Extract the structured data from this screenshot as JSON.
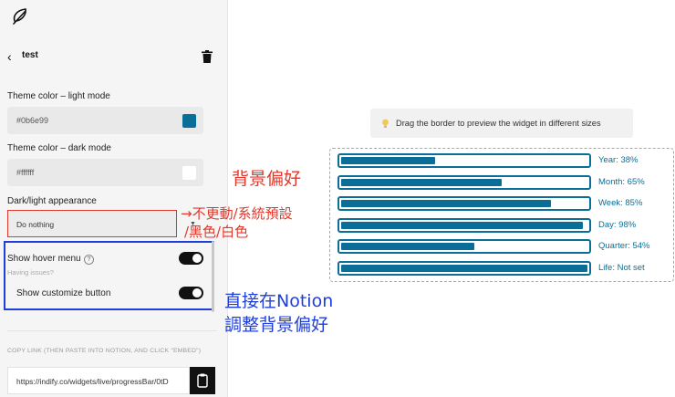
{
  "header": {
    "back_title": "test"
  },
  "settings": {
    "light_label": "Theme color – light mode",
    "light_value": "#0b6e99",
    "light_color": "#0b6e99",
    "dark_label": "Theme color – dark mode",
    "dark_value": "#ffffff",
    "dark_color": "#ffffff",
    "appearance_label": "Dark/light appearance",
    "appearance_value": "Do nothing",
    "hover_label": "Show hover menu",
    "having_issues": "Having issues?",
    "customize_label": "Show customize button",
    "copy_label": "COPY LINK (THEN PASTE INTO NOTION, AND CLICK \"EMBED\")",
    "link_value": "https://indify.co/widgets/live/progressBar/0tD"
  },
  "annotations": {
    "red_title": "背景偏好",
    "red_line1": "→不更動/系統預設",
    "red_line2": "/黑色/白色",
    "blue_line1": "直接在Notion",
    "blue_line2": "調整背景偏好"
  },
  "preview": {
    "hint": "Drag the border to preview the widget in different sizes",
    "bars": [
      {
        "label": "Year: 38%",
        "percent": 38
      },
      {
        "label": "Month: 65%",
        "percent": 65
      },
      {
        "label": "Week: 85%",
        "percent": 85
      },
      {
        "label": "Day: 98%",
        "percent": 98
      },
      {
        "label": "Quarter: 54%",
        "percent": 54
      },
      {
        "label": "Life: Not set",
        "percent": 100
      }
    ]
  },
  "icons": {
    "logo": "feather-icon",
    "back": "chevron-left-icon",
    "delete": "trash-icon",
    "help": "question-circle-icon",
    "dropdown": "caret-down-icon",
    "copy": "clipboard-icon",
    "hint": "lightbulb-icon"
  }
}
